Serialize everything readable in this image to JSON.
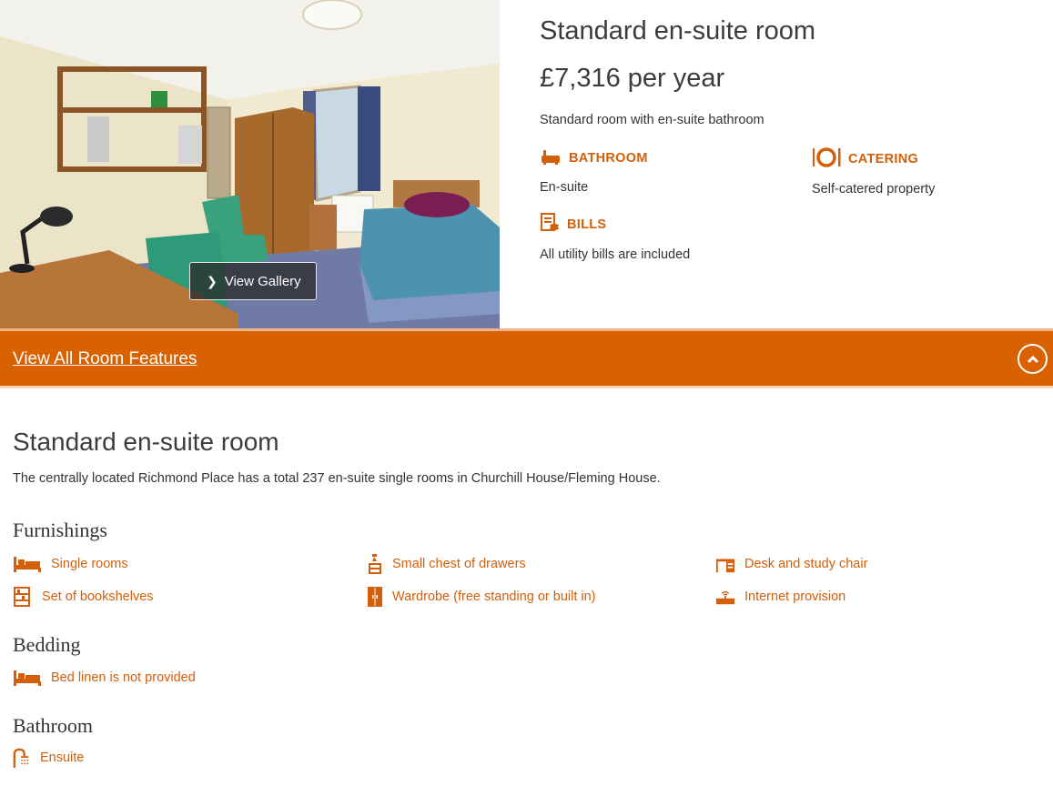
{
  "gallery": {
    "button_label": "View Gallery"
  },
  "room": {
    "title": "Standard en-suite room",
    "price": "£7,316 per year",
    "description": "Standard room with en-suite bathroom",
    "features": {
      "bathroom": {
        "label": "BATHROOM",
        "value": "En-suite",
        "icon": "bath-icon"
      },
      "catering": {
        "label": "CATERING",
        "value": "Self-catered property",
        "icon": "plate-cutlery-icon"
      },
      "bills": {
        "label": "BILLS",
        "value": "All utility bills are included",
        "icon": "bill-icon"
      }
    }
  },
  "features_bar": {
    "link_label": "View All Room Features",
    "toggle_icon": "chevron-up-icon"
  },
  "details": {
    "title": "Standard en-suite room",
    "text": "The centrally located Richmond Place has a total 237 en-suite single rooms in Churchill House/Fleming House.",
    "furnishings": {
      "heading": "Furnishings",
      "items": [
        {
          "label": "Single rooms",
          "icon": "bed-icon"
        },
        {
          "label": "Small chest of drawers",
          "icon": "drawers-icon"
        },
        {
          "label": "Desk and study chair",
          "icon": "desk-icon"
        },
        {
          "label": "Set of bookshelves",
          "icon": "bookshelf-icon"
        },
        {
          "label": "Wardrobe (free standing or built in)",
          "icon": "wardrobe-icon"
        },
        {
          "label": "Internet provision",
          "icon": "router-icon"
        }
      ]
    },
    "bedding": {
      "heading": "Bedding",
      "items": [
        {
          "label": "Bed linen is not provided",
          "icon": "bed-icon"
        }
      ]
    },
    "bathroom": {
      "heading": "Bathroom",
      "items": [
        {
          "label": "Ensuite",
          "icon": "shower-icon"
        }
      ]
    }
  },
  "colors": {
    "accent": "#d96100",
    "accent_text": "#d35f0a"
  }
}
